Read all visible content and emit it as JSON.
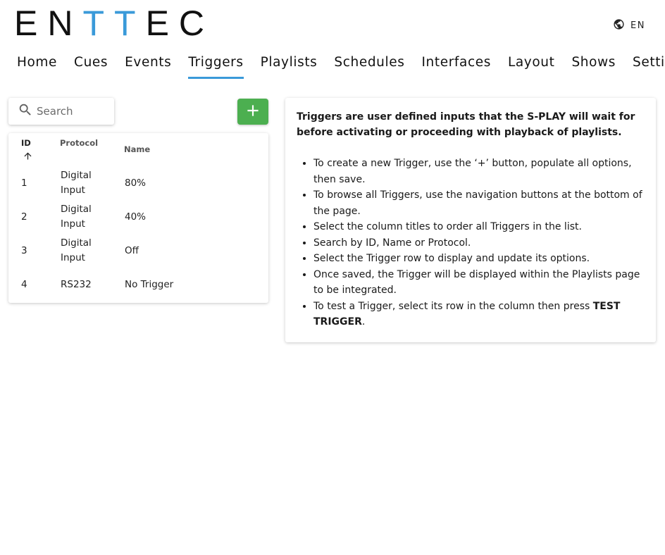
{
  "brand": {
    "letters": [
      {
        "char": "E",
        "color": "dark"
      },
      {
        "char": "N",
        "color": "dark"
      },
      {
        "char": "T",
        "color": "blue"
      },
      {
        "char": "T",
        "color": "blue"
      },
      {
        "char": "E",
        "color": "dark"
      },
      {
        "char": "C",
        "color": "dark"
      }
    ],
    "accent_color": "#3a9ad9"
  },
  "language": {
    "icon": "globe-icon",
    "label": "EN"
  },
  "nav": {
    "tabs": [
      {
        "label": "Home"
      },
      {
        "label": "Cues"
      },
      {
        "label": "Events"
      },
      {
        "label": "Triggers",
        "active": true
      },
      {
        "label": "Playlists"
      },
      {
        "label": "Schedules"
      },
      {
        "label": "Interfaces"
      },
      {
        "label": "Layout"
      },
      {
        "label": "Shows"
      },
      {
        "label": "Settings"
      }
    ]
  },
  "search": {
    "placeholder": "Search",
    "value": "",
    "icon": "search-icon"
  },
  "add_button": {
    "icon": "plus-icon",
    "color": "#4caf50"
  },
  "table": {
    "columns": {
      "id": "ID",
      "protocol": "Protocol",
      "name": "Name"
    },
    "sort": {
      "column": "ID",
      "direction": "ascending",
      "icon": "arrow-up-icon"
    },
    "rows": [
      {
        "id": "1",
        "protocol_line1": "Digital",
        "protocol_line2": "Input",
        "name": "80%"
      },
      {
        "id": "2",
        "protocol_line1": "Digital",
        "protocol_line2": "Input",
        "name": "40%"
      },
      {
        "id": "3",
        "protocol_line1": "Digital",
        "protocol_line2": "Input",
        "name": "Off"
      },
      {
        "id": "4",
        "protocol_line1": "RS232",
        "protocol_line2": "",
        "name": "No Trigger"
      }
    ]
  },
  "info": {
    "intro": "Triggers are user defined inputs that the S-PLAY will wait for before activating or proceeding with playback of playlists.",
    "bullets": [
      {
        "text": "To create a new Trigger, use the ‘+’ button, populate all options, then save."
      },
      {
        "text": "To browse all Triggers, use the navigation buttons at the bottom of the page."
      },
      {
        "text": "Select the column titles to order all Triggers in the list."
      },
      {
        "text": "Search by ID, Name or Protocol."
      },
      {
        "text": "Select the Trigger row to display and update its options."
      },
      {
        "text": "Once saved, the Trigger will be displayed within the Playlists page to be integrated."
      },
      {
        "text": "To test a Trigger, select its row in the column then press ",
        "bold": "TEST TRIGGER",
        "suffix": "."
      }
    ]
  }
}
